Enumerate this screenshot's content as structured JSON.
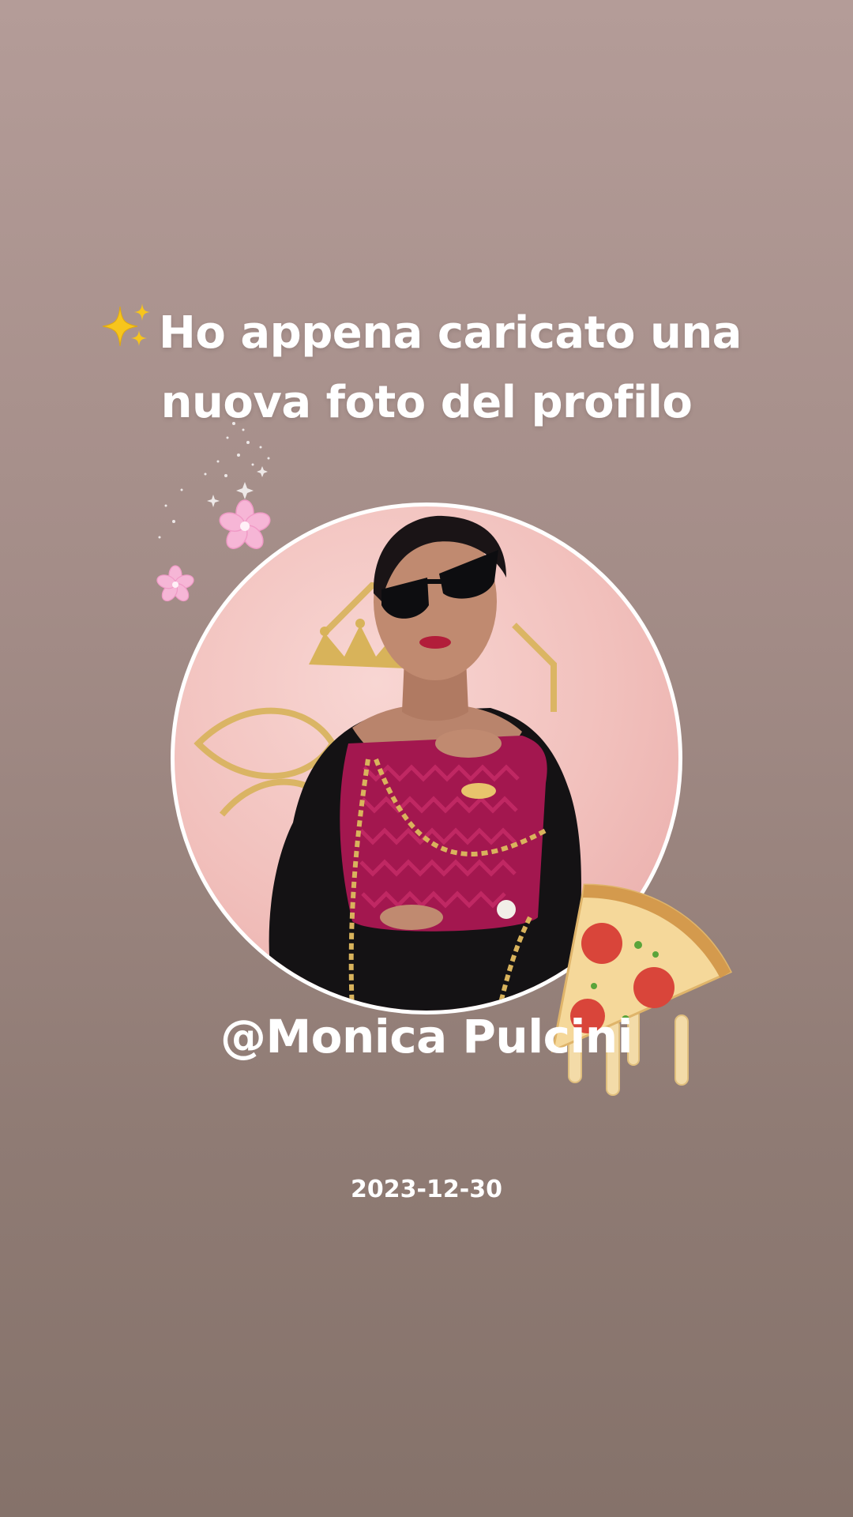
{
  "story": {
    "headline_line1": "Ho appena caricato una",
    "headline_line2": "nuova foto del profilo",
    "username": "@Monica Pulcini",
    "date": "2023-12-30"
  },
  "icons": {
    "sparkles": "sparkles-icon",
    "flowers": "cherry-blossom-icon",
    "pizza": "pizza-slice-icon"
  },
  "colors": {
    "background_top": "#b49c98",
    "background_bottom": "#85726a",
    "text": "#ffffff",
    "photo_bg": "#f1bfbb",
    "bag": "#a3174f"
  }
}
